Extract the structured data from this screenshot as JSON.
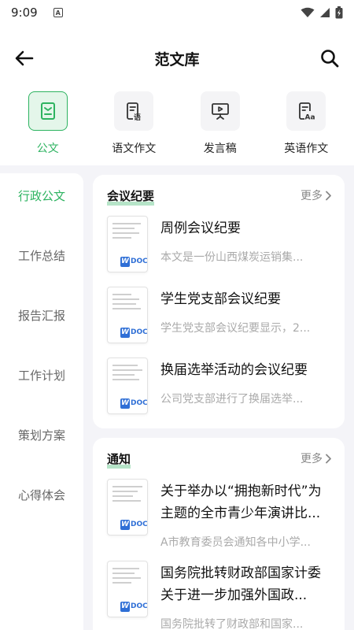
{
  "status": {
    "time": "9:09",
    "indicator": "A"
  },
  "header": {
    "title": "范文库"
  },
  "categories": [
    {
      "label": "公文",
      "icon": "doc-icon"
    },
    {
      "label": "语文作文",
      "icon": "chinese-essay-icon"
    },
    {
      "label": "发言稿",
      "icon": "speech-icon"
    },
    {
      "label": "英语作文",
      "icon": "english-essay-icon"
    }
  ],
  "sidebar": {
    "items": [
      "行政公文",
      "工作总结",
      "报告汇报",
      "工作计划",
      "策划方案",
      "心得体会"
    ],
    "active": "行政公文"
  },
  "sections": [
    {
      "title": "会议纪要",
      "more": "更多",
      "articles": [
        {
          "title": "周例会议纪要",
          "desc": "本文是一份山西煤炭运销集..."
        },
        {
          "title": "学生党支部会议纪要",
          "desc": "学生党支部会议纪要显示，2..."
        },
        {
          "title": "换届选举活动的会议纪要",
          "desc": "公司党支部进行了换届选举..."
        }
      ]
    },
    {
      "title": "通知",
      "more": "更多",
      "articles": [
        {
          "title": "关于举办以“拥抱新时代”为主题的全市青少年演讲比...",
          "desc": "A市教育委员会通知各中小学..."
        },
        {
          "title": "国务院批转财政部国家计委关于进一步加强外国政...",
          "desc": "国务院批转了财政部和国家..."
        }
      ]
    }
  ],
  "doc_badge": {
    "w": "W",
    "text": "DOC"
  },
  "colors": {
    "accent": "#2db360",
    "doc_blue": "#2f6fd6",
    "background": "#f4f4f8"
  }
}
